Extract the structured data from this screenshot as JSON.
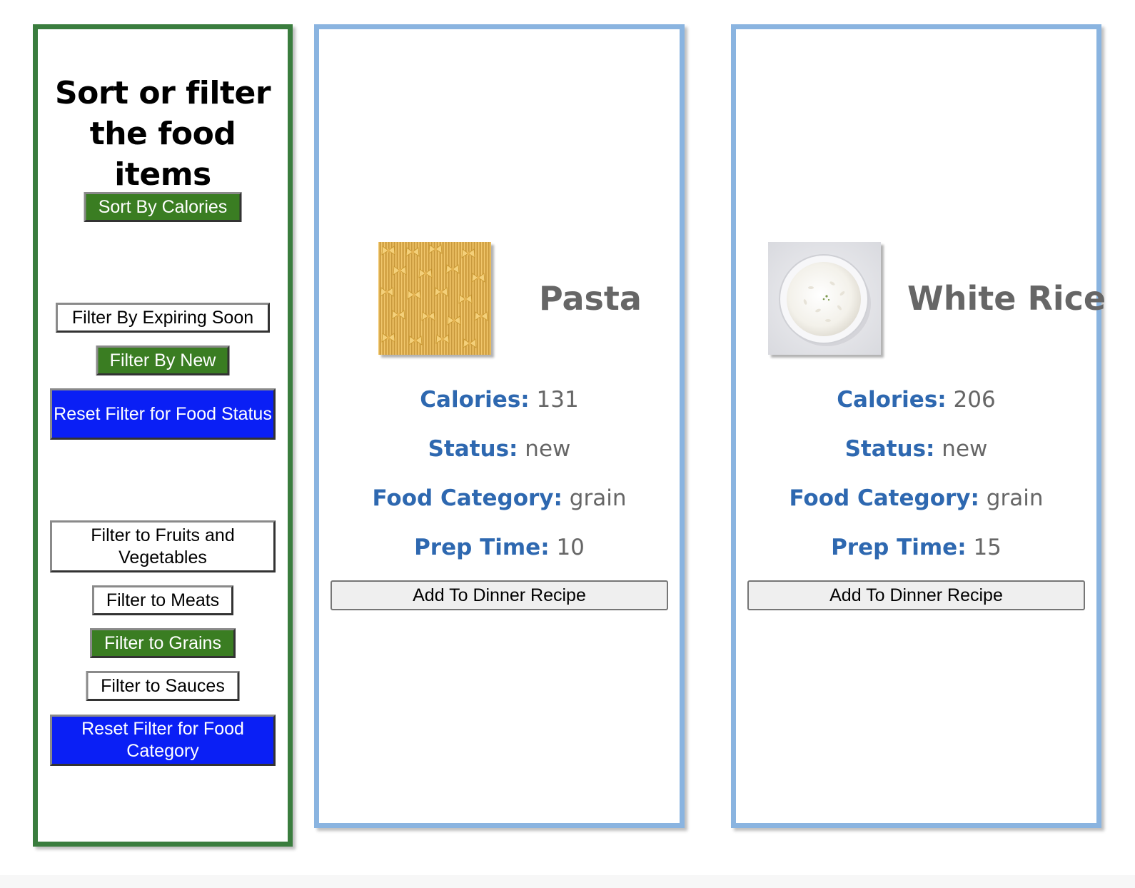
{
  "sidebar": {
    "title_line1": "Sort or filter",
    "title_line2": "the food items",
    "sort_calories": "Sort By Calories",
    "filter_expiring": "Filter By Expiring Soon",
    "filter_new": "Filter By New",
    "reset_status": "Reset Filter for Food Status",
    "filter_fruits": "Filter to Fruits and Vegetables",
    "filter_meats": "Filter to Meats",
    "filter_grains": "Filter to Grains",
    "filter_sauces": "Filter to Sauces",
    "reset_category": "Reset Filter for Food Category"
  },
  "labels": {
    "calories": "Calories:",
    "status": "Status:",
    "category": "Food Category:",
    "prep": "Prep Time:",
    "add_button": "Add To Dinner Recipe"
  },
  "cards": [
    {
      "name": "Pasta",
      "image": "pasta-image",
      "calories": "131",
      "status": "new",
      "category": "grain",
      "prep_time": "10"
    },
    {
      "name": "White Rice",
      "image": "rice-bowl-image",
      "calories": "206",
      "status": "new",
      "category": "grain",
      "prep_time": "15"
    }
  ],
  "colors": {
    "sidebar_border": "#3a7d3e",
    "card_border": "#8ab4e0",
    "green_button": "#3a7d22",
    "blue_button": "#0a1ff5",
    "label_blue": "#2e68b0",
    "value_gray": "#666666"
  }
}
